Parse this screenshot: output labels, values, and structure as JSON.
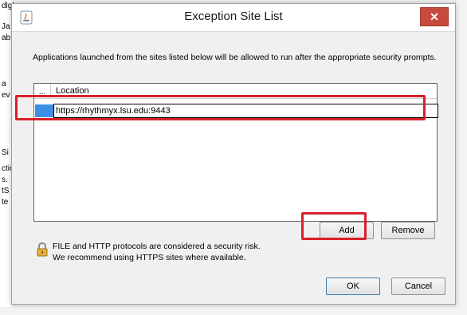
{
  "dialog": {
    "title": "Exception Site List",
    "description": "Applications launched from the sites listed below will be allowed to run after the appropriate security prompts.",
    "table": {
      "columns": [
        "...",
        "Location"
      ],
      "rows": [
        {
          "location": "https://rhythmyx.lsu.edu:9443"
        }
      ]
    },
    "buttons": {
      "add": "Add",
      "remove": "Remove",
      "ok": "OK",
      "cancel": "Cancel"
    },
    "warning": {
      "line1": "FILE and HTTP protocols are considered a security risk.",
      "line2": "We recommend using HTTPS sites where available."
    },
    "close_glyph": "✕",
    "icons": {
      "title": "java-icon",
      "warning": "lock-icon",
      "close": "close-icon"
    }
  },
  "background_fragments": {
    "left_lines": [
      "dlgh",
      "Ja",
      "ab",
      "a",
      "ev",
      "Si",
      "ctio",
      "s.",
      "tS",
      "te"
    ]
  },
  "colors": {
    "highlight": "#d9202a",
    "selection": "#3b8ee3",
    "close_button": "#c74b3c"
  }
}
